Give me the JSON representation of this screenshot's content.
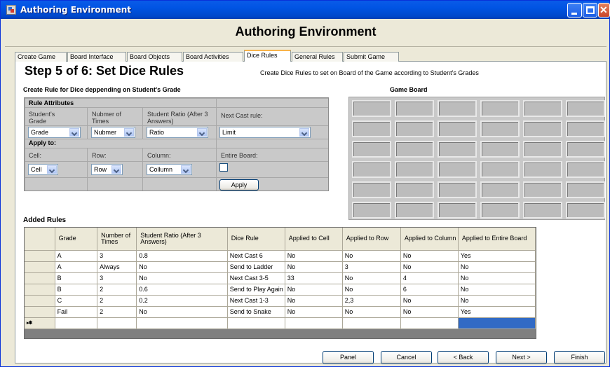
{
  "window": {
    "title": "Authoring Environment"
  },
  "app": {
    "title": "Authoring Environment"
  },
  "tabs": [
    {
      "label": "Create Game"
    },
    {
      "label": "Board Interface"
    },
    {
      "label": "Board Objects"
    },
    {
      "label": "Board Activities"
    },
    {
      "label": "Dice Rules",
      "active": true
    },
    {
      "label": "General Rules"
    },
    {
      "label": "Submit Game"
    }
  ],
  "step": {
    "title": "Step 5 of 6: Set Dice Rules",
    "description": "Create Dice Rules to set on Board of the Game according to Student's Grades"
  },
  "rule_form": {
    "heading": "Create Rule for Dice deppending on Student's Grade",
    "section_attributes": "Rule Attributes",
    "grade_label": "Student's Grade",
    "times_label": "Nubmer of Times",
    "ratio_label": "Student Ratio (After 3 Answers)",
    "next_cast_label": "Next Cast rule:",
    "grade_value": "Grade",
    "times_value": "Nubmer",
    "ratio_value": "Ratio",
    "limit_value": "Limit",
    "section_apply": "Apply to:",
    "cell_label": "Cell:",
    "row_label": "Row:",
    "column_label": "Column:",
    "entire_board_label": "Entire Board:",
    "cell_value": "Cell",
    "row_value": "Row",
    "column_value": "Collumn",
    "apply_button": "Apply"
  },
  "game_board": {
    "heading": "Game Board",
    "rows": 6,
    "cols": 6
  },
  "added_rules": {
    "heading": "Added Rules",
    "columns": [
      "Grade",
      "Number of Times",
      "Student Ratio (After 3 Answers)",
      "Dice Rule",
      "Applied to Cell",
      "Applied to Row",
      "Applied to Column",
      "Applied to Entire Board"
    ],
    "rows": [
      [
        "A",
        "3",
        "0.8",
        "Next Cast 6",
        "No",
        "No",
        "No",
        "Yes"
      ],
      [
        "A",
        "Always",
        "No",
        "Send to Ladder",
        "No",
        "3",
        "No",
        "No"
      ],
      [
        "B",
        "3",
        "No",
        "Next Cast 3-5",
        "33",
        "No",
        "4",
        "No"
      ],
      [
        "B",
        "2",
        "0.6",
        "Send to Play Again",
        "No",
        "No",
        "6",
        "No"
      ],
      [
        "C",
        "2",
        "0.2",
        "Next Cast 1-3",
        "No",
        "2,3",
        "No",
        "No"
      ],
      [
        "Fail",
        "2",
        "No",
        "Send to Snake",
        "No",
        "No",
        "No",
        "Yes"
      ]
    ],
    "new_row_marker": "▸✱"
  },
  "nav": {
    "panel": "Panel",
    "cancel": "Cancel",
    "back": "< Back",
    "next": "Next >",
    "finish": "Finish"
  }
}
